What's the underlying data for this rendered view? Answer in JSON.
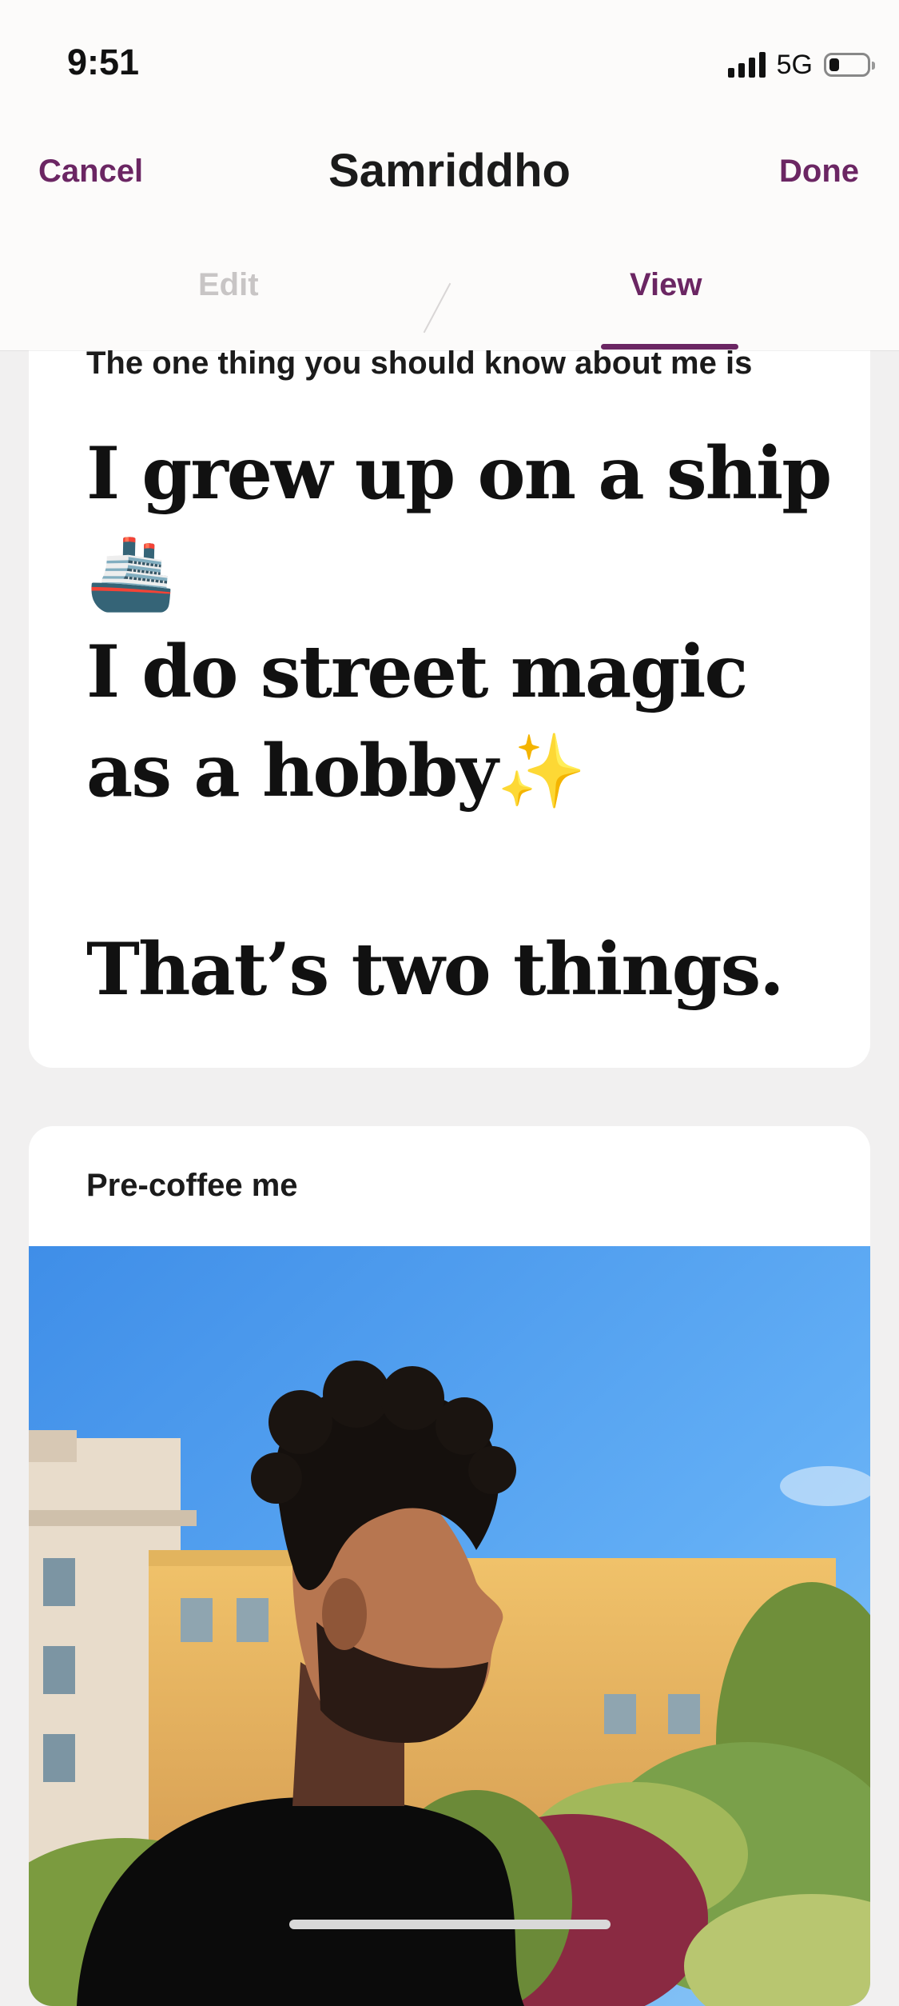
{
  "status_bar": {
    "time": "9:51",
    "network": "5G",
    "signal_bars": 4,
    "battery_level": 0.25
  },
  "header": {
    "title": "Samriddho",
    "cancel_label": "Cancel",
    "done_label": "Done",
    "tabs": [
      {
        "label": "Edit",
        "active": false
      },
      {
        "label": "View",
        "active": true
      }
    ]
  },
  "prompt_card": {
    "prompt": "The one thing you should know about me is",
    "answer": "I grew up on a ship 🚢\nI do street magic as a hobby✨\n\nThat’s two things."
  },
  "photo_card": {
    "prompt": "Pre-coffee me"
  },
  "colors": {
    "accent": "#6b2663",
    "background": "#f1f0f0",
    "header_bg": "#fcfbfa",
    "inactive_tab": "#c8c5c5"
  }
}
